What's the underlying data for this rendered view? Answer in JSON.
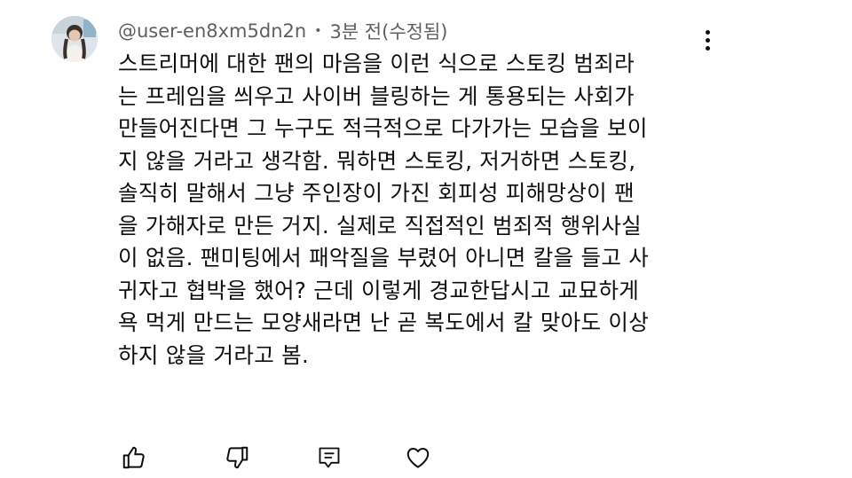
{
  "comment": {
    "author": "@user-en8xm5dn2n",
    "separator": "•",
    "time": "3분 전(수정됨)",
    "lines": [
      "스트리머에 대한 팬의 마음을 이런 식으로 스토킹 범죄라",
      "는 프레임을 씌우고 사이버 블링하는 게 통용되는 사회가",
      "만들어진다면 그 누구도 적극적으로 다가가는 모습을 보이",
      "지 않을 거라고 생각함. 뭐하면 스토킹, 저거하면 스토킹,",
      "솔직히 말해서 그냥 주인장이 가진 회피성 피해망상이 팬",
      "을 가해자로 만든 거지. 실제로 직접적인 범죄적 행위사실",
      "이 없음. 팬미팅에서 패악질을 부렸어 아니면 칼을 들고 사",
      "귀자고 협박을 했어? 근데 이렇게 경교한답시고 교묘하게",
      "욕 먹게 만드는 모양새라면 난 곧 복도에서 칼 맞아도 이상",
      "하지 않을 거라고 봄."
    ]
  },
  "icons": {
    "avatar": "avatar-photo",
    "more": "more-vertical-icon",
    "like": "thumbs-up-icon",
    "dislike": "thumbs-down-icon",
    "reply": "reply-icon",
    "heart": "heart-icon"
  }
}
